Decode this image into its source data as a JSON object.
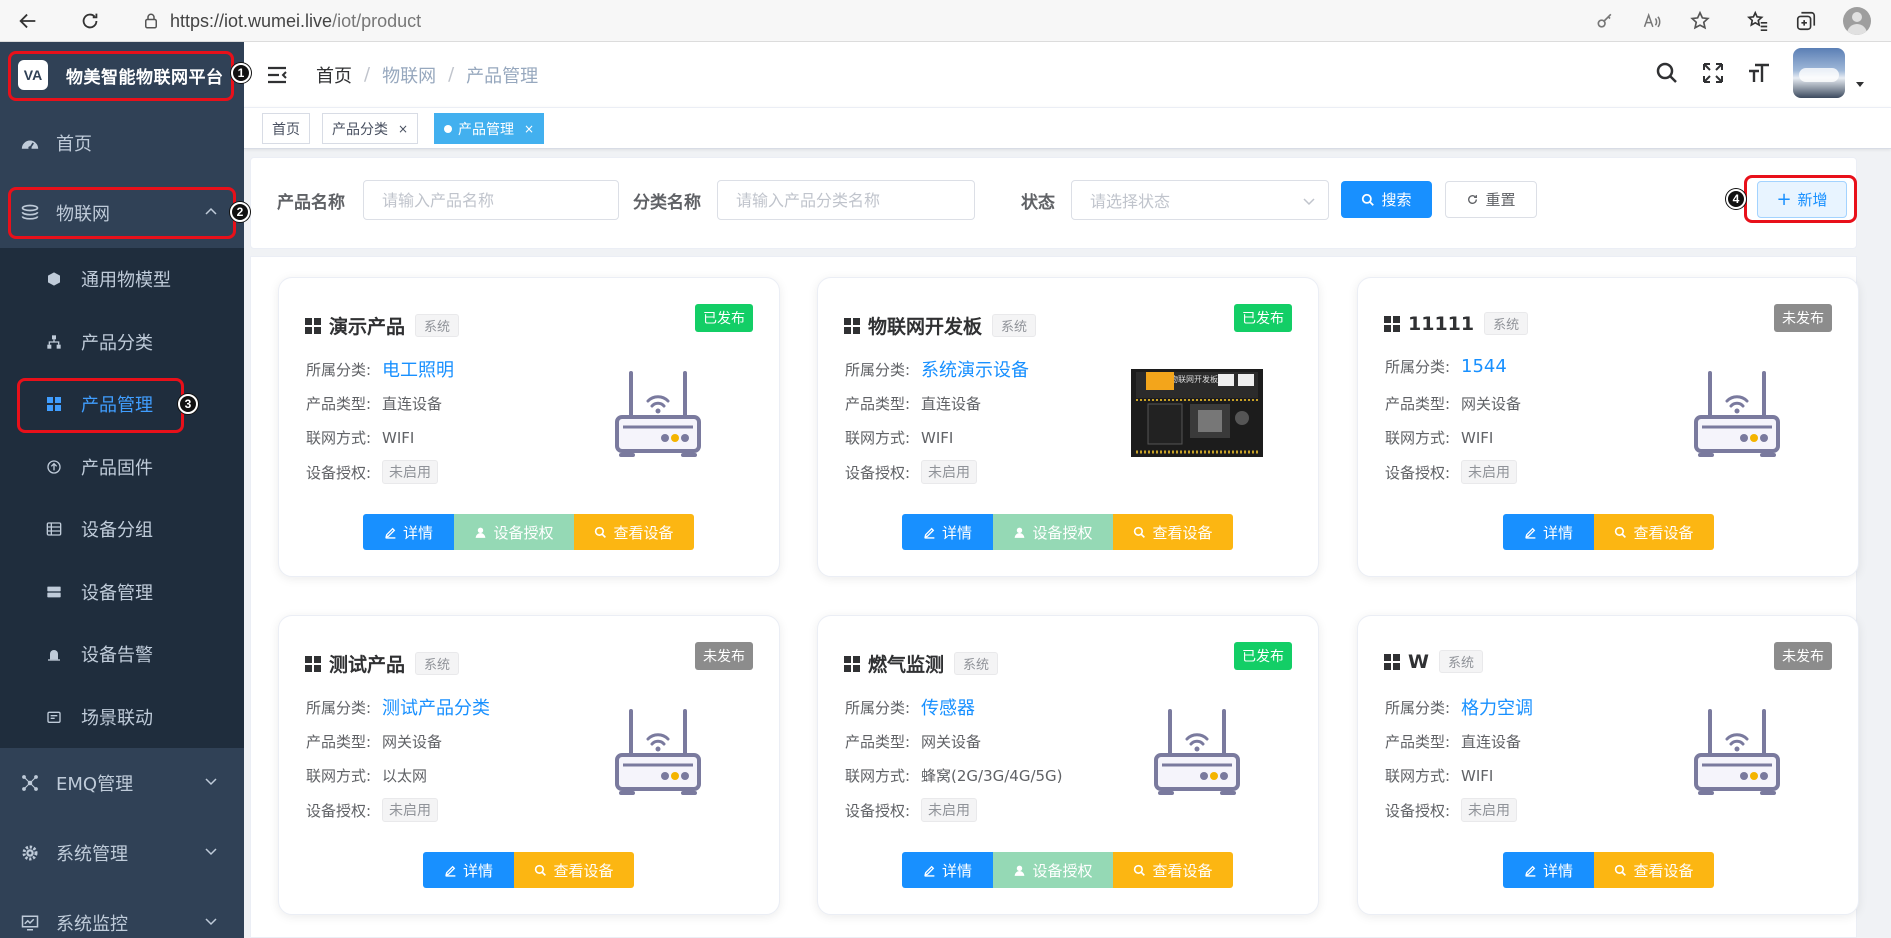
{
  "browser": {
    "url_host": "https://iot.wumei.live",
    "url_path": "/iot/product"
  },
  "sidebar": {
    "logo_text": "VA",
    "title": "物美智能物联网平台",
    "items": [
      {
        "label": "首页"
      },
      {
        "label": "物联网"
      },
      {
        "label": "EMQ管理"
      },
      {
        "label": "系统管理"
      },
      {
        "label": "系统监控"
      }
    ],
    "sub_items": [
      {
        "label": "通用物模型"
      },
      {
        "label": "产品分类"
      },
      {
        "label": "产品管理"
      },
      {
        "label": "产品固件"
      },
      {
        "label": "设备分组"
      },
      {
        "label": "设备管理"
      },
      {
        "label": "设备告警"
      },
      {
        "label": "场景联动"
      }
    ]
  },
  "header": {
    "breadcrumb": [
      "首页",
      "物联网",
      "产品管理"
    ]
  },
  "tags": [
    {
      "label": "首页"
    },
    {
      "label": "产品分类",
      "close": "×"
    },
    {
      "label": "产品管理",
      "close": "×"
    }
  ],
  "search": {
    "product_name_label": "产品名称",
    "product_name_placeholder": "请输入产品名称",
    "category_label": "分类名称",
    "category_placeholder": "请输入产品分类名称",
    "status_label": "状态",
    "status_placeholder": "请选择状态",
    "search_btn": "搜索",
    "reset_btn": "重置",
    "add_btn": "新增"
  },
  "markers": [
    "1",
    "2",
    "3",
    "4"
  ],
  "card_labels": {
    "category": "所属分类:",
    "type": "产品类型:",
    "network": "联网方式:",
    "auth": "设备授权:",
    "detail_btn": "详情",
    "auth_btn": "设备授权",
    "view_btn": "查看设备"
  },
  "cards": [
    {
      "name": "演示产品",
      "sys": "系统",
      "status": "已发布",
      "category": "电工照明",
      "type": "直连设备",
      "network": "WIFI",
      "auth": "未启用"
    },
    {
      "name": "物联网开发板",
      "sys": "系统",
      "status": "已发布",
      "category": "系统演示设备",
      "type": "直连设备",
      "network": "WIFI",
      "auth": "未启用"
    },
    {
      "name": "11111",
      "sys": "系统",
      "status": "未发布",
      "category": "1544",
      "type": "网关设备",
      "network": "WIFI",
      "auth": "未启用"
    },
    {
      "name": "测试产品",
      "sys": "系统",
      "status": "未发布",
      "category": "测试产品分类",
      "type": "网关设备",
      "network": "以太网",
      "auth": "未启用"
    },
    {
      "name": "燃气监测",
      "sys": "系统",
      "status": "已发布",
      "category": "传感器",
      "type": "网关设备",
      "network": "蜂窝(2G/3G/4G/5G)",
      "auth": "未启用"
    },
    {
      "name": "W",
      "sys": "系统",
      "status": "未发布",
      "category": "格力空调",
      "type": "直连设备",
      "network": "WIFI",
      "auth": "未启用"
    }
  ],
  "colors": {
    "sidebar_bg": "#304156",
    "submenu_bg": "#1f2d3d",
    "primary": "#1890ff",
    "published": "#13ce66",
    "unpublished": "#8c8c8c",
    "warning": "#fcb612",
    "highlight": "#e8101a"
  }
}
